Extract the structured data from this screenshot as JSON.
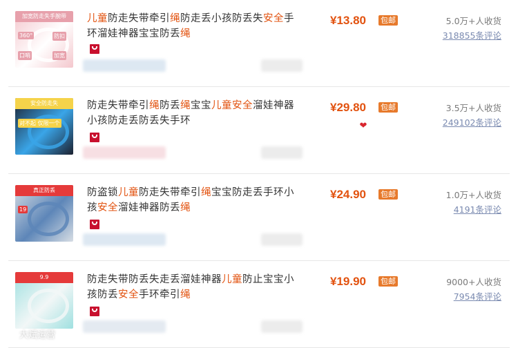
{
  "products": [
    {
      "title_segments": [
        {
          "text": "儿童",
          "hl": true
        },
        {
          "text": "防走失带牵引",
          "hl": false
        },
        {
          "text": "绳",
          "hl": true
        },
        {
          "text": "防走丢小孩防丢失",
          "hl": false
        },
        {
          "text": "安全",
          "hl": true
        },
        {
          "text": "手环溜娃神器宝宝防丢",
          "hl": false
        },
        {
          "text": "绳",
          "hl": true
        }
      ],
      "price": "¥13.80",
      "free_shipping": "包邮",
      "buyers": "5.0万+人收货",
      "reviews": "318855条评论",
      "thumb_text": [
        "加宽防走失手腕带",
        "360°",
        "口哨",
        "加宽",
        "防扣"
      ],
      "thumb_colors": [
        "#f4c7cd",
        "#ffffff",
        "#e7a0ab"
      ]
    },
    {
      "title_segments": [
        {
          "text": "防走失带牵引",
          "hl": false
        },
        {
          "text": "绳",
          "hl": true
        },
        {
          "text": "防丢",
          "hl": false
        },
        {
          "text": "绳",
          "hl": true
        },
        {
          "text": "宝宝",
          "hl": false
        },
        {
          "text": "儿童",
          "hl": true
        },
        {
          "text": "安全",
          "hl": true
        },
        {
          "text": "溜娃神器小孩防走丢防丢失手环",
          "hl": false
        }
      ],
      "price": "¥29.80",
      "free_shipping": "包邮",
      "buyers": "3.5万+人收货",
      "reviews": "249102条评论",
      "thumb_text": [
        "安全防走失",
        "对不起 仅限一个"
      ],
      "thumb_colors": [
        "#1c2130",
        "#3aa5e8",
        "#f5d34a"
      ]
    },
    {
      "title_segments": [
        {
          "text": "防盗锁",
          "hl": false
        },
        {
          "text": "儿童",
          "hl": true
        },
        {
          "text": "防走失带牵引",
          "hl": false
        },
        {
          "text": "绳",
          "hl": true
        },
        {
          "text": "宝宝防走丢手环小孩",
          "hl": false
        },
        {
          "text": "安全",
          "hl": true
        },
        {
          "text": "溜娃神器防丢",
          "hl": false
        },
        {
          "text": "绳",
          "hl": true
        }
      ],
      "price": "¥24.90",
      "free_shipping": "包邮",
      "buyers": "1.0万+人收货",
      "reviews": "4191条评论",
      "thumb_text": [
        "真正防丢",
        "19"
      ],
      "thumb_colors": [
        "#d7dde4",
        "#5d86b8",
        "#e53a3a"
      ]
    },
    {
      "title_segments": [
        {
          "text": "防走失带防丢失走丢溜娃神器",
          "hl": false
        },
        {
          "text": "儿童",
          "hl": true
        },
        {
          "text": "防止宝宝小孩防丢",
          "hl": false
        },
        {
          "text": "安全",
          "hl": true
        },
        {
          "text": "手环牵引",
          "hl": false
        },
        {
          "text": "绳",
          "hl": true
        }
      ],
      "price": "¥19.90",
      "free_shipping": "包邮",
      "buyers": "9000+人收货",
      "reviews": "7954条评论",
      "thumb_text": [
        "9.9"
      ],
      "thumb_colors": [
        "#9fe0e0",
        "#f2f7f7",
        "#e53a3a"
      ]
    }
  ],
  "watermark": "大斌运营"
}
